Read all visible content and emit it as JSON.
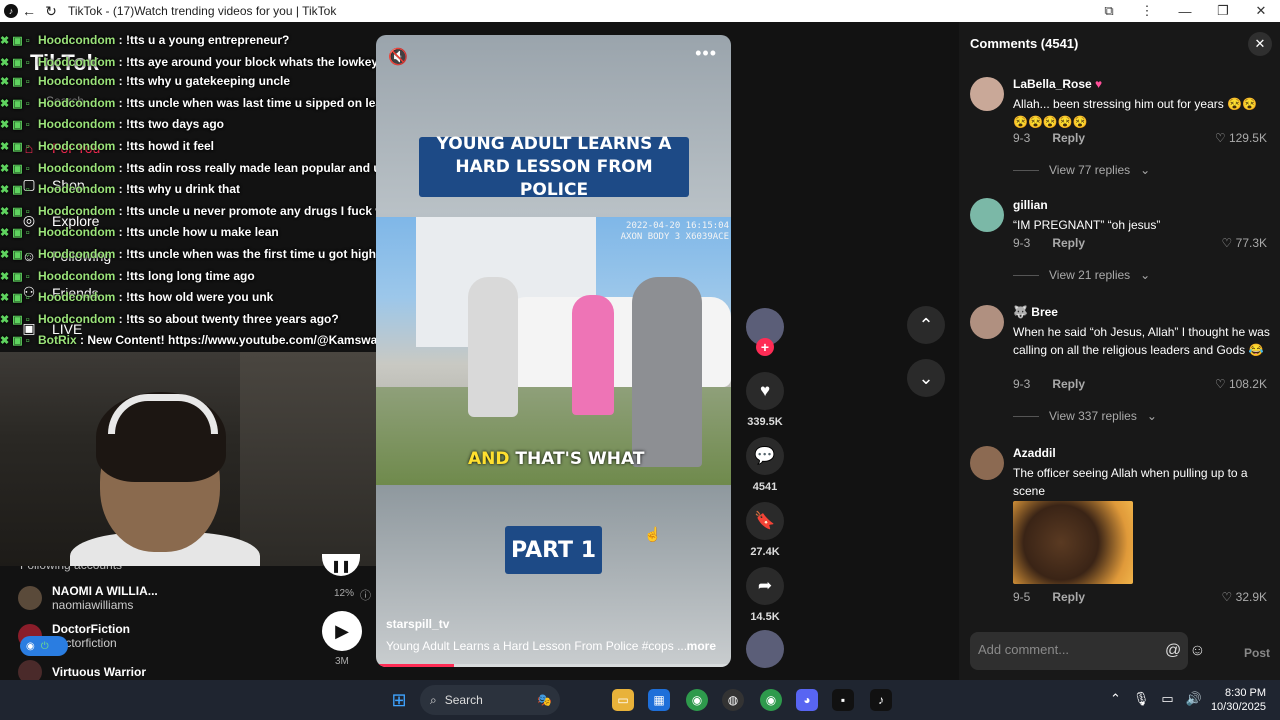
{
  "window": {
    "title": "TikTok - (17)Watch trending videos for you | TikTok",
    "controls": [
      "—",
      "❐",
      "✕"
    ]
  },
  "sidebar": {
    "logo": "TikTok",
    "search_placeholder": "Search",
    "items": [
      {
        "label": "For You",
        "icon": "home-icon",
        "top": 0
      },
      {
        "label": "Shop",
        "icon": "shop-icon"
      },
      {
        "label": "Explore",
        "icon": "compass-icon"
      },
      {
        "label": "Following",
        "icon": "following-icon"
      },
      {
        "label": "Friends",
        "icon": "friends-icon"
      },
      {
        "label": "LIVE",
        "icon": "live-icon"
      }
    ],
    "following_header": "Following accounts",
    "accounts": [
      {
        "name": "NAOMI A WILLIA...",
        "handle": "naomiawilliams"
      },
      {
        "name": "DoctorFiction",
        "handle": "doctorfiction"
      },
      {
        "name": "Virtuous Warrior",
        "handle": ""
      }
    ]
  },
  "chat": {
    "lines": [
      {
        "name": "Hoodcondom",
        "msg": "!tts u a young entrepreneur?"
      },
      {
        "name": "Hoodcondom",
        "msg": "!tts aye around your block whats the lowkey spot no one know about"
      },
      {
        "name": "Hoodcondom",
        "msg": "!tts why u gatekeeping uncle"
      },
      {
        "name": "Hoodcondom",
        "msg": "!tts uncle when was last time u sipped on lean"
      },
      {
        "name": "Hoodcondom",
        "msg": "!tts two days ago"
      },
      {
        "name": "Hoodcondom",
        "msg": "!tts howd it feel"
      },
      {
        "name": "Hoodcondom",
        "msg": "!tts adin ross really made lean popular and u copied him"
      },
      {
        "name": "Hoodcondom",
        "msg": "!tts why u drink that"
      },
      {
        "name": "Hoodcondom",
        "msg": "!tts uncle u never promote any drugs I fuck with that"
      },
      {
        "name": "Hoodcondom",
        "msg": "!tts uncle how u make lean"
      },
      {
        "name": "Hoodcondom",
        "msg": "!tts uncle when was the first time u got high"
      },
      {
        "name": "Hoodcondom",
        "msg": "!tts long long time ago"
      },
      {
        "name": "Hoodcondom",
        "msg": "!tts how old were you unk"
      },
      {
        "name": "Hoodcondom",
        "msg": "!tts so about twenty three years ago?"
      },
      {
        "name": "BotRix",
        "msg": "New Content! https://www.youtube.com/@Kamswaelive"
      }
    ]
  },
  "stream_overlay": {
    "progress_label": "12%",
    "viewer_count": "3M"
  },
  "video": {
    "banner": "YOUNG ADULT LEARNS A HARD LESSON FROM POLICE",
    "timestamp": "2022-04-20 16:15:04",
    "camera_id": "AXON BODY 3 X6039ACE",
    "caption_yellow": "AND",
    "caption_white": "THAT'S WHAT",
    "part_label": "PART 1",
    "author": "starspill_tv",
    "description": "Young Adult Learns a Hard Lesson From Police #cops ...",
    "more_label": "more",
    "progress": 0.22
  },
  "actions": {
    "likes": "339.5K",
    "comments": "4541",
    "saves": "27.4K",
    "shares": "14.5K"
  },
  "comments_panel": {
    "header": "Comments (4541)",
    "items": [
      {
        "user": "LaBella_Rose",
        "text": "Allah... been stressing him out for years",
        "date": "9-3",
        "reply": "Reply",
        "likes": "129.5K",
        "view_replies": "View 77 replies"
      },
      {
        "user": "gillian",
        "text": "“IM PREGNANT” “oh jesus”",
        "date": "9-3",
        "reply": "Reply",
        "likes": "77.3K",
        "view_replies": "View 21 replies"
      },
      {
        "user": "Bree",
        "text": "When he said “oh Jesus, Allah” I thought he was calling on all the religious leaders and Gods",
        "date": "9-3",
        "reply": "Reply",
        "likes": "108.2K",
        "view_replies": "View 337 replies"
      },
      {
        "user": "Azaddil",
        "text": "The officer seeing Allah when pulling up to a scene",
        "date": "9-5",
        "reply": "Reply",
        "likes": "32.9K"
      }
    ],
    "input_placeholder": "Add comment...",
    "post_label": "Post"
  },
  "taskbar": {
    "search_label": "Search",
    "time": "8:30 PM",
    "date": "10/30/2025"
  }
}
